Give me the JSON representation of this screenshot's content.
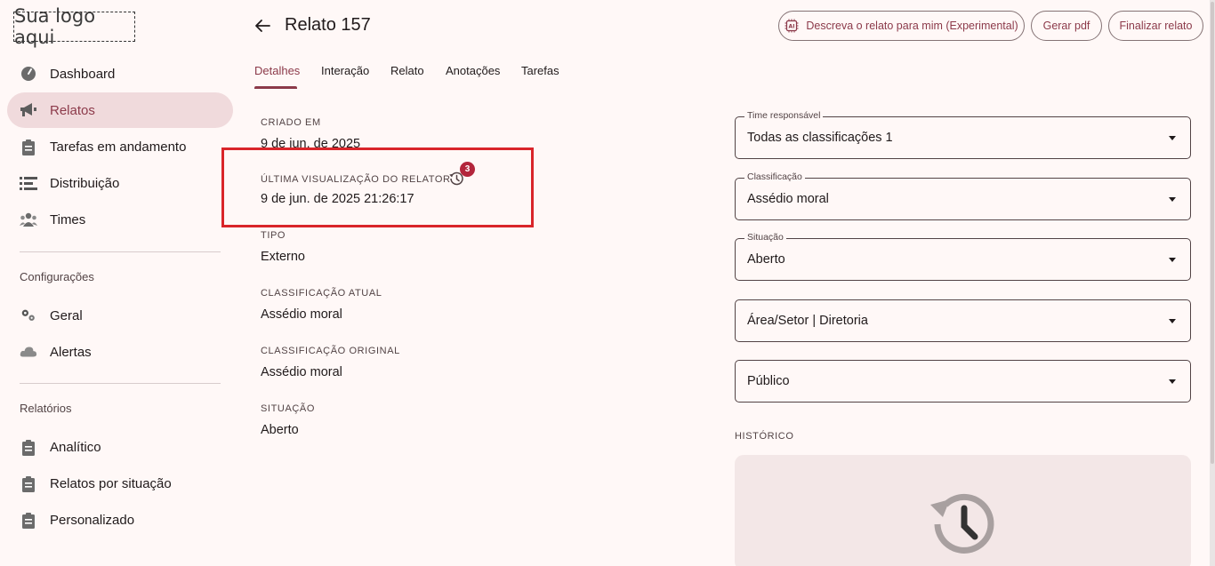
{
  "logo": {
    "text": "Sua logo aqui"
  },
  "sidebar": {
    "main_items": [
      {
        "label": "Dashboard",
        "icon": "speedometer-icon"
      },
      {
        "label": "Relatos",
        "icon": "megaphone-icon",
        "active": true
      },
      {
        "label": "Tarefas em andamento",
        "icon": "clipboard-icon"
      },
      {
        "label": "Distribuição",
        "icon": "list-bars-icon"
      },
      {
        "label": "Times",
        "icon": "people-icon"
      }
    ],
    "config_title": "Configurações",
    "config_items": [
      {
        "label": "Geral",
        "icon": "gears-icon"
      },
      {
        "label": "Alertas",
        "icon": "alert-cloud-icon"
      }
    ],
    "reports_title": "Relatórios",
    "report_items": [
      {
        "label": "Analítico",
        "icon": "clipboard-icon"
      },
      {
        "label": "Relatos por situação",
        "icon": "clipboard-icon"
      },
      {
        "label": "Personalizado",
        "icon": "clipboard-icon"
      }
    ]
  },
  "header": {
    "title": "Relato 157",
    "describe_button": "Descreva o relato para mim (Experimental)",
    "pdf_button": "Gerar pdf",
    "finish_button": "Finalizar relato"
  },
  "tabs": [
    "Detalhes",
    "Interação",
    "Relato",
    "Anotações",
    "Tarefas"
  ],
  "details": {
    "created_label": "CRIADO EM",
    "created_value": "9 de jun. de 2025",
    "last_view_label": "ÚLTIMA VISUALIZAÇÃO DO RELATOR",
    "last_view_value": "9 de jun. de 2025 21:26:17",
    "history_badge": "3",
    "type_label": "TIPO",
    "type_value": "Externo",
    "current_class_label": "CLASSIFICAÇÃO ATUAL",
    "current_class_value": "Assédio moral",
    "original_class_label": "CLASSIFICAÇÃO ORIGINAL",
    "original_class_value": "Assédio moral",
    "status_label": "SITUAÇÃO",
    "status_value": "Aberto"
  },
  "selects": {
    "team": {
      "legend": "Time responsável",
      "value": "Todas as classificações 1"
    },
    "classification": {
      "legend": "Classificação",
      "value": "Assédio moral"
    },
    "status": {
      "legend": "Situação",
      "value": "Aberto"
    },
    "area": {
      "value": "Área/Setor | Diretoria"
    },
    "audience": {
      "value": "Público"
    }
  },
  "history": {
    "label": "HISTÓRICO"
  },
  "colors": {
    "accent": "#8c3a4a",
    "active_bg": "#f0dadc",
    "highlight": "#d9252a",
    "badge": "#b3263c",
    "background": "#fff8f7"
  }
}
